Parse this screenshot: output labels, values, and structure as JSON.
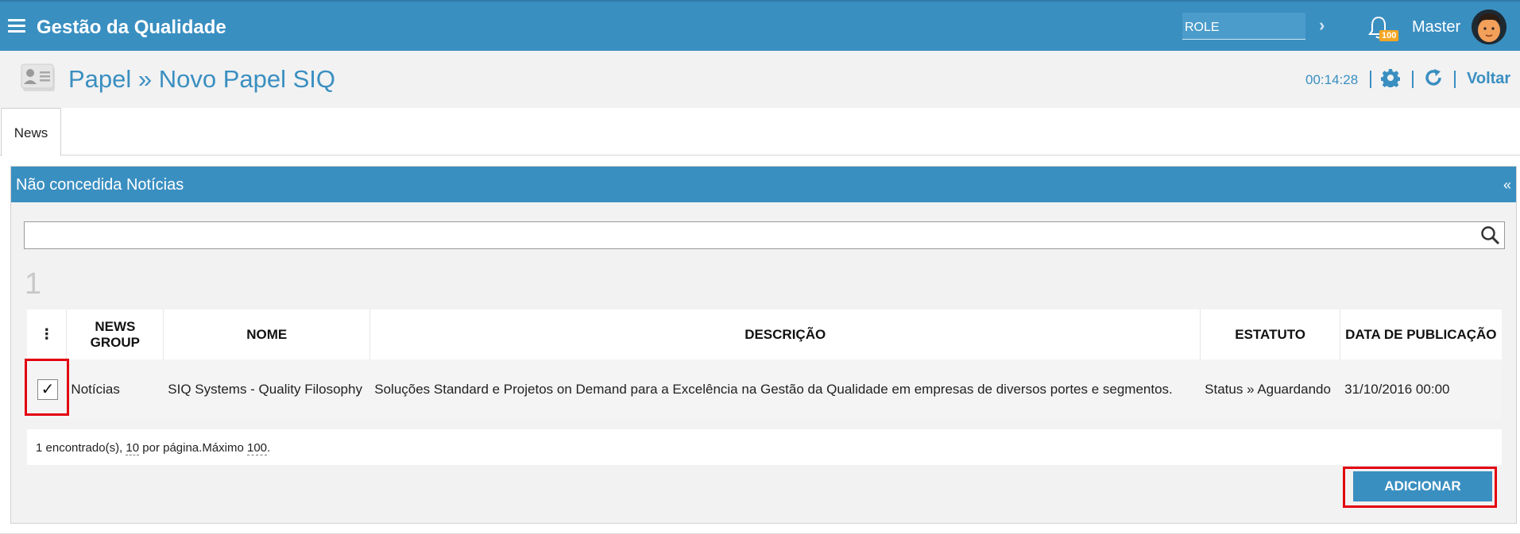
{
  "app": {
    "title": "Gestão da Qualidade",
    "role_placeholder": "ROLE",
    "notification_count": "100",
    "user_name": "Master"
  },
  "header": {
    "page_title": "Papel » Novo Papel SIQ",
    "timer": "00:14:28",
    "back_label": "Voltar"
  },
  "tabs": [
    {
      "label": "News",
      "active": true
    }
  ],
  "panel": {
    "title": "Não concedida Notícias",
    "collapse_glyph": "«",
    "search_value": "",
    "count": "1",
    "columns": [
      "⋮",
      "NEWS GROUP",
      "NOME",
      "DESCRIÇÃO",
      "ESTATUTO",
      "DATA DE PUBLICAÇÃO"
    ],
    "rows": [
      {
        "checked": true,
        "news_group": "Notícias",
        "nome": "SIQ Systems - Quality Filosophy",
        "descricao": "Soluções Standard e Projetos on Demand para a Excelência na Gestão da Qualidade em empresas de diversos portes e segmentos.",
        "estatuto": "Status » Aguardando",
        "data": "31/10/2016 00:00"
      }
    ],
    "footer": {
      "found": "1 encontrado(s), ",
      "per_page": "10",
      "per_page_text": " por página.Máximo ",
      "max": "100",
      "end": "."
    },
    "add_button": "ADICIONAR"
  },
  "colors": {
    "primary": "#3a8fc1",
    "highlight": "#e3000f",
    "badge": "#f5a623"
  }
}
